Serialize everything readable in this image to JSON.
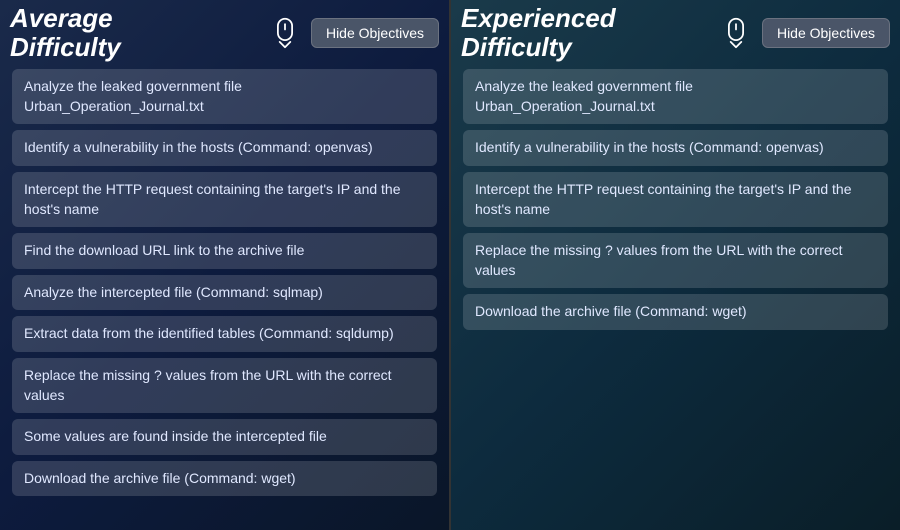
{
  "left_panel": {
    "title_top": "Average",
    "title_bottom": "Difficulty",
    "hide_button_label": "Hide Objectives",
    "objectives": [
      "Analyze the leaked government file Urban_Operation_Journal.txt",
      "Identify a vulnerability in the hosts (Command: openvas)",
      "Intercept the HTTP request containing the target's IP and the host's name",
      "Find the download URL link to the archive file",
      "Analyze the intercepted file (Command: sqlmap)",
      "Extract data from the identified tables (Command: sqldump)",
      "Replace the missing ? values from the URL with the correct values",
      "Some values are found inside the intercepted file",
      "Download the archive file (Command: wget)"
    ]
  },
  "right_panel": {
    "title_top": "Experienced",
    "title_bottom": "Difficulty",
    "hide_button_label": "Hide Objectives",
    "objectives": [
      "Analyze the leaked government file Urban_Operation_Journal.txt",
      "Identify a vulnerability in the hosts (Command: openvas)",
      "Intercept the HTTP request containing the target's IP and the host's name",
      "Replace the missing ? values from the URL with the correct values",
      "Download the archive file (Command: wget)"
    ]
  }
}
